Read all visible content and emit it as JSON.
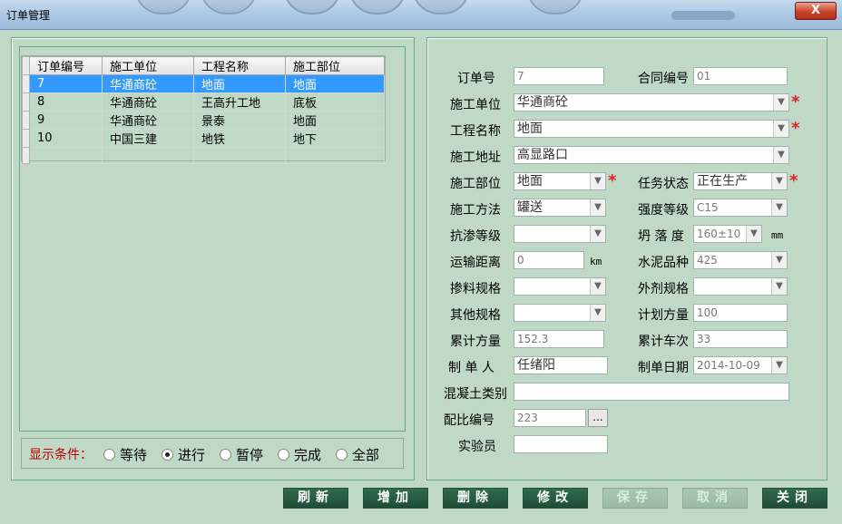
{
  "window": {
    "title": "订单管理",
    "close_label": "X"
  },
  "grid": {
    "headers": [
      "订单编号",
      "施工单位",
      "工程名称",
      "施工部位"
    ],
    "rows": [
      [
        "7",
        "华通商砼",
        "地面",
        "地面"
      ],
      [
        "8",
        "华通商砼",
        "王高升工地",
        "底板"
      ],
      [
        "9",
        "华通商砼",
        "景泰",
        "地面"
      ],
      [
        "10",
        "中国三建",
        "地铁",
        "地下"
      ]
    ]
  },
  "filter": {
    "label": "显示条件：",
    "options": [
      "等待",
      "进行",
      "暂停",
      "完成",
      "全部"
    ],
    "selected": "进行"
  },
  "form": {
    "order_no": {
      "label": "订单号",
      "value": "7"
    },
    "contract_no": {
      "label": "合同编号",
      "value": "01"
    },
    "contractor": {
      "label": "施工单位",
      "value": "华通商砼"
    },
    "project": {
      "label": "工程名称",
      "value": "地面"
    },
    "address": {
      "label": "施工地址",
      "value": "高显路口"
    },
    "part": {
      "label": "施工部位",
      "value": "地面"
    },
    "task_status": {
      "label": "任务状态",
      "value": "正在生产"
    },
    "method": {
      "label": "施工方法",
      "value": "罐送"
    },
    "strength": {
      "label": "强度等级",
      "value": "C15"
    },
    "impermeability": {
      "label": "抗渗等级",
      "value": ""
    },
    "slump": {
      "label": "坍 落 度",
      "value": "160±10",
      "unit": "mm"
    },
    "distance": {
      "label": "运输距离",
      "value": "0",
      "unit": "km"
    },
    "cement": {
      "label": "水泥品种",
      "value": "425"
    },
    "admixture_spec": {
      "label": "掺料规格",
      "value": ""
    },
    "additive_spec": {
      "label": "外剂规格",
      "value": ""
    },
    "other_spec": {
      "label": "其他规格",
      "value": ""
    },
    "planned_volume": {
      "label": "计划方量",
      "value": "100"
    },
    "cumulative_volume": {
      "label": "累计方量",
      "value": "152.3"
    },
    "cumulative_trips": {
      "label": "累计车次",
      "value": "33"
    },
    "creator": {
      "label": "制 单 人",
      "value": "任绪阳"
    },
    "created_date": {
      "label": "制单日期",
      "value": "2014-10-09"
    },
    "concrete_type": {
      "label": "混凝土类别",
      "value": ""
    },
    "mix_no": {
      "label": "配比编号",
      "value": "223",
      "button": "..."
    },
    "tester": {
      "label": "实验员",
      "value": ""
    }
  },
  "required_mark": "*",
  "buttons": {
    "refresh": "刷新",
    "add": "增加",
    "delete": "删除",
    "modify": "修改",
    "save": "保存",
    "cancel": "取消",
    "close": "关闭"
  }
}
